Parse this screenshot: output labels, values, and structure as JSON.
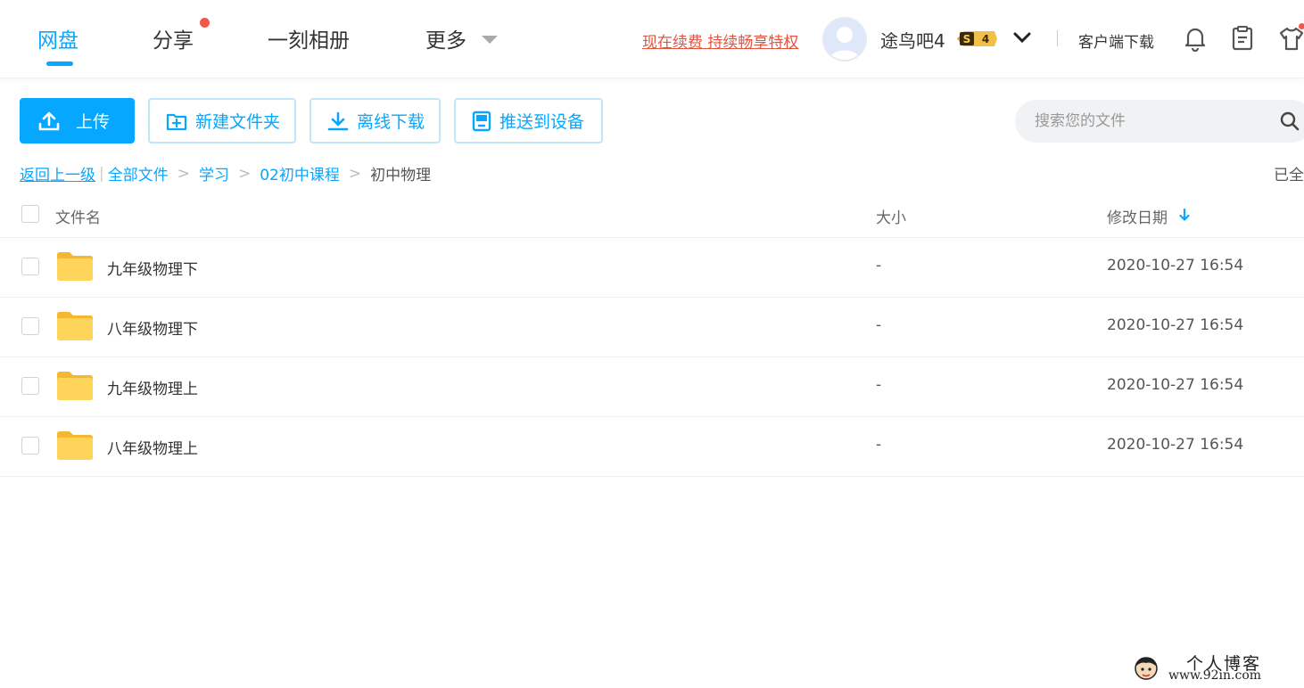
{
  "nav": {
    "items": [
      {
        "label": "网盘",
        "active": true
      },
      {
        "label": "分享",
        "has_dot": true
      },
      {
        "label": "一刻相册"
      },
      {
        "label": "更多"
      }
    ],
    "renew_link": "现在续费 持续畅享特权",
    "username": "途鸟吧4",
    "vip_level": "4",
    "vip_symbol": "S",
    "client_download": "客户端下载"
  },
  "toolbar": {
    "upload": "上传",
    "new_folder": "新建文件夹",
    "offline_download": "离线下载",
    "push_to_device": "推送到设备"
  },
  "search": {
    "placeholder": "搜索您的文件",
    "value": ""
  },
  "breadcrumb": {
    "back": "返回上一级",
    "path": [
      "全部文件",
      "学习",
      "02初中课程"
    ],
    "current": "初中物理",
    "separator": ">",
    "pipe": "|"
  },
  "status": {
    "loaded": "已全"
  },
  "table": {
    "headers": {
      "name": "文件名",
      "size": "大小",
      "modified": "修改日期"
    },
    "rows": [
      {
        "name": "九年级物理下",
        "size": "-",
        "modified": "2020-10-27 16:54"
      },
      {
        "name": "八年级物理下",
        "size": "-",
        "modified": "2020-10-27 16:54"
      },
      {
        "name": "九年级物理上",
        "size": "-",
        "modified": "2020-10-27 16:54"
      },
      {
        "name": "八年级物理上",
        "size": "-",
        "modified": "2020-10-27 16:54"
      }
    ]
  },
  "watermark": {
    "title": "个人博客",
    "url": "www.92in.com"
  },
  "colors": {
    "accent": "#06a7ff",
    "warning": "#e5533e",
    "folder": "#ffd45a"
  }
}
